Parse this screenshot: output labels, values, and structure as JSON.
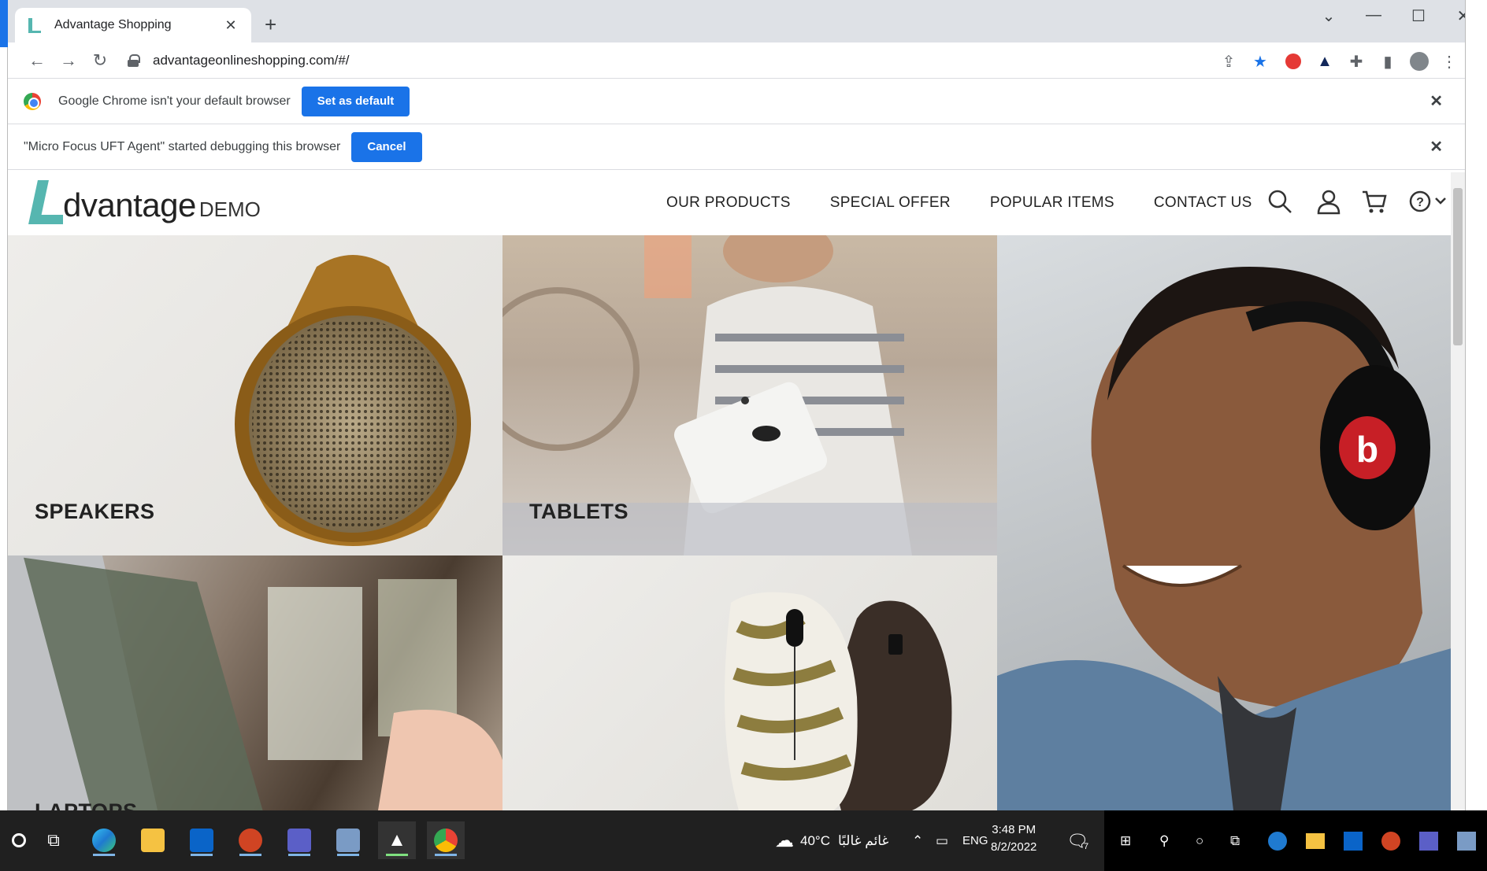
{
  "browser": {
    "tab_title": "Advantage Shopping",
    "url": "advantageonlineshopping.com/#/",
    "new_tab_symbol": "+",
    "tab_close_symbol": "✕"
  },
  "infobars": {
    "default_browser": {
      "message": "Google Chrome isn't your default browser",
      "button": "Set as default"
    },
    "debugging": {
      "message": "\"Micro Focus UFT Agent\" started debugging this browser",
      "button": "Cancel"
    },
    "close_symbol": "✕"
  },
  "site": {
    "logo_text": "dvantage",
    "logo_demo": "DEMO",
    "nav": [
      "OUR PRODUCTS",
      "SPECIAL OFFER",
      "POPULAR ITEMS",
      "CONTACT US"
    ],
    "tiles": {
      "speakers": "SPEAKERS",
      "tablets": "TABLETS",
      "laptops": "LAPTOPS"
    },
    "colors": {
      "brand": "#56b6b0"
    }
  },
  "taskbar": {
    "weather": "40°C",
    "weather_desc": "غائم غالبًا",
    "language": "ENG",
    "time": "3:48 PM",
    "date": "8/2/2022",
    "notification_count": "7"
  }
}
